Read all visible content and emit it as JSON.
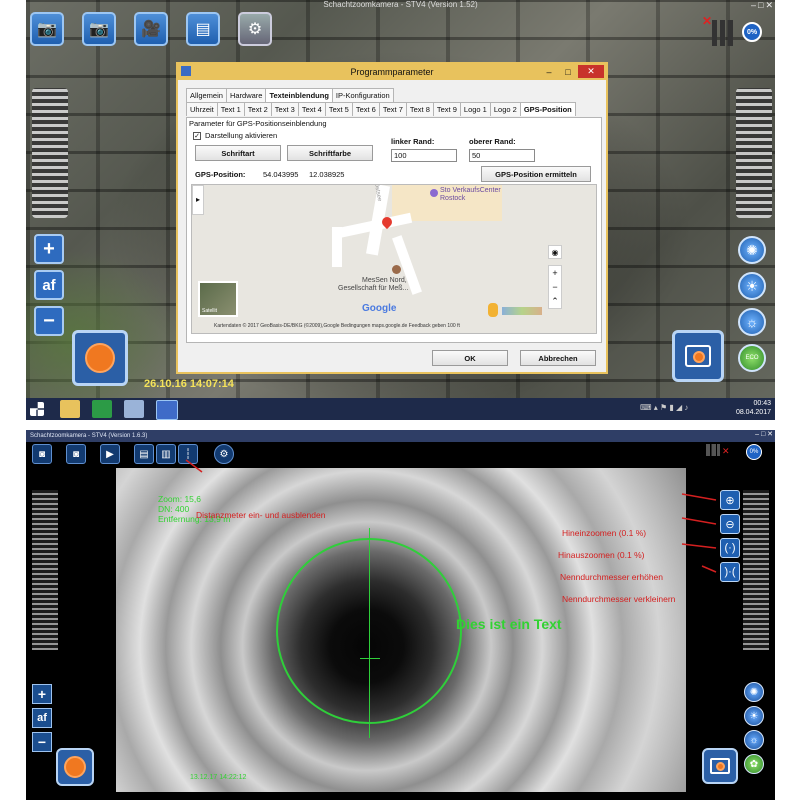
{
  "top": {
    "window_title": "Schachtzoomkamera - STV4   (Version 1.52)",
    "storage_badge": "0%",
    "af_label": "af",
    "plus_label": "+",
    "minus_label": "−",
    "eco_label": "ECO",
    "timestamp_overlay": "26.10.16 14:07:14",
    "dialog": {
      "title": "Programmparameter",
      "main_tabs": [
        "Allgemein",
        "Hardware",
        "Texteinblendung",
        "IP-Konfiguration"
      ],
      "sub_tabs": [
        "Uhrzeit",
        "Text 1",
        "Text 2",
        "Text 3",
        "Text 4",
        "Text 5",
        "Text 6",
        "Text 7",
        "Text 8",
        "Text 9",
        "Logo 1",
        "Logo 2",
        "GPS-Position"
      ],
      "group_title": "Parameter für GPS-Positionseinblendung",
      "checkbox_label": "Darstellung aktivieren",
      "font_button": "Schriftart",
      "color_button": "Schriftfarbe",
      "left_margin_label": "linker Rand:",
      "left_margin_value": "100",
      "top_margin_label": "oberer Rand:",
      "top_margin_value": "50",
      "gps_label": "GPS-Position:",
      "gps_lat": "54.043995",
      "gps_lon": "12.038925",
      "gps_button": "GPS-Position ermitteln",
      "map": {
        "poi_1": "Sto VerkaufsCenter",
        "poi_1b": "Rostock",
        "poi_2": "MesSen Nord,",
        "poi_2b": "Gesellschaft für Meß...",
        "street": "Ostsee",
        "satellite_label": "Satellit",
        "google": "Google",
        "footer": "Kartendaten © 2017 GeoBasis-DE/BKG (©2009),Google    Bedingungen    maps.google.de    Feedback geben    100 ft"
      },
      "ok_button": "OK",
      "cancel_button": "Abbrechen"
    },
    "taskbar_time": "00:43",
    "taskbar_date": "08.04.2017"
  },
  "bottom": {
    "window_title": "Schachtzoomkamera - STV4   (Version 1.6.3)",
    "storage_badge": "0%",
    "af_label": "af",
    "plus_label": "+",
    "minus_label": "−",
    "zoom_info": [
      "Zoom: 15,6",
      "DN: 400",
      "Entfernung: 13,9 m"
    ],
    "overlay_text": "Dies ist ein Text",
    "timestamp_overlay": "13.12.17 14:22:12",
    "annotations": {
      "distance": "Distanzmeter ein- und ausblenden",
      "zoom_in": "Hineinzoomen (0.1 %)",
      "zoom_out": "Hinauszoomen (0.1 %)",
      "diameter_up": "Nenndurchmesser erhöhen",
      "diameter_down": "Nenndurchmesser verkleinern"
    },
    "colors": {
      "annotation": "#d42020",
      "overlay_green": "#32d232"
    }
  }
}
